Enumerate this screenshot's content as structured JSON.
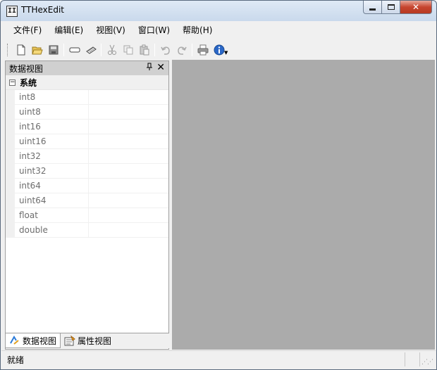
{
  "window": {
    "title": "TTHexEdit",
    "app_icon_glyph": "II",
    "min_icon": "minimize-icon",
    "max_icon": "maximize-icon",
    "close_glyph": "✕"
  },
  "menu": {
    "items": [
      {
        "label": "文件(F)"
      },
      {
        "label": "编辑(E)"
      },
      {
        "label": "视图(V)"
      },
      {
        "label": "窗口(W)"
      },
      {
        "label": "帮助(H)"
      }
    ]
  },
  "toolbar": {
    "buttons": [
      "new-file-icon",
      "open-folder-icon",
      "save-icon",
      "insert-icon",
      "overwrite-icon",
      "cut-icon",
      "copy-icon",
      "paste-icon",
      "undo-icon",
      "redo-icon",
      "print-icon",
      "info-icon"
    ],
    "dropdown_arrow": "▼"
  },
  "data_pane": {
    "title": "数据视图",
    "pin_glyph": "🖈",
    "close_glyph": "✕",
    "group": {
      "expander": "−",
      "label": "系统"
    },
    "rows": [
      {
        "name": "int8",
        "value": ""
      },
      {
        "name": "uint8",
        "value": ""
      },
      {
        "name": "int16",
        "value": ""
      },
      {
        "name": "uint16",
        "value": ""
      },
      {
        "name": "int32",
        "value": ""
      },
      {
        "name": "uint32",
        "value": ""
      },
      {
        "name": "int64",
        "value": ""
      },
      {
        "name": "uint64",
        "value": ""
      },
      {
        "name": "float",
        "value": ""
      },
      {
        "name": "double",
        "value": ""
      }
    ]
  },
  "bottom_tabs": [
    {
      "label": "数据视图",
      "icon": "data-view-icon",
      "active": true
    },
    {
      "label": "属性视图",
      "icon": "property-view-icon",
      "active": false
    }
  ],
  "status": {
    "text": "就绪",
    "grip": "⋰⋰"
  },
  "colors": {
    "client_background": "#ababab",
    "pane_header": "#d0d0d0",
    "close_button": "#c6452f"
  }
}
